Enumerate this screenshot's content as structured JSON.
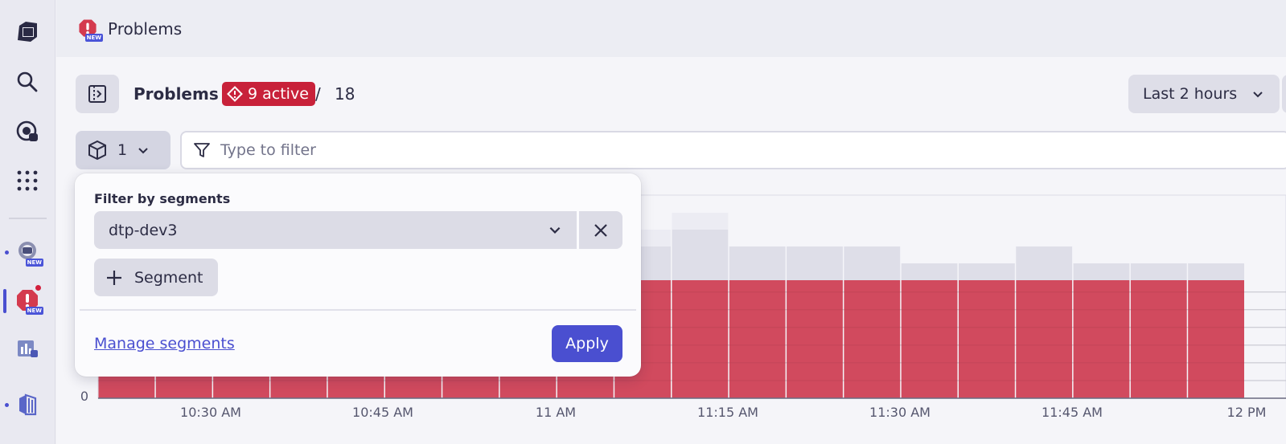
{
  "header": {
    "title": "Problems",
    "app_badge": "NEW"
  },
  "rail": {
    "new_badge": "NEW"
  },
  "toolbar": {
    "title": "Problems",
    "active_label": "9 active",
    "separator": "/",
    "total": "18",
    "timeframe": "Last 2 hours"
  },
  "segment_button": {
    "count": "1"
  },
  "filter": {
    "placeholder": "Type to filter",
    "value": ""
  },
  "popover": {
    "label": "Filter by segments",
    "selected_segment": "dtp-dev3",
    "add_label": "Segment",
    "manage_link": "Manage segments",
    "apply_label": "Apply"
  },
  "colors": {
    "accent": "#4a4fd0",
    "problem": "#c8213a",
    "bar": "#d14a5e",
    "bar_light": "#dcdce6"
  },
  "chart_data": {
    "type": "bar",
    "series": [
      {
        "values": [
          7,
          7,
          7,
          7,
          7,
          7,
          7,
          7,
          7,
          7,
          7,
          7,
          7,
          7,
          7,
          7,
          7,
          7,
          7,
          7
        ]
      },
      {
        "values": [
          1,
          1,
          1,
          1,
          1,
          1,
          1,
          1,
          1,
          1,
          1,
          1,
          1,
          1,
          1,
          1,
          1,
          1,
          1,
          1
        ]
      },
      {
        "values": [
          1,
          1,
          1,
          1,
          1,
          1,
          1,
          1,
          1,
          1,
          2,
          1,
          1,
          1,
          0,
          0,
          1,
          0,
          0,
          0
        ]
      },
      {
        "values": [
          1,
          1,
          1,
          1,
          1,
          1,
          1,
          1,
          1,
          1,
          1,
          0,
          0,
          0,
          0,
          0,
          0,
          0,
          0,
          0
        ]
      }
    ],
    "x_ticks": [
      "10:30 AM",
      "10:45 AM",
      "11 AM",
      "11:15 AM",
      "11:30 AM",
      "11:45 AM",
      "12 PM"
    ],
    "y_ticks": [
      "0"
    ]
  }
}
